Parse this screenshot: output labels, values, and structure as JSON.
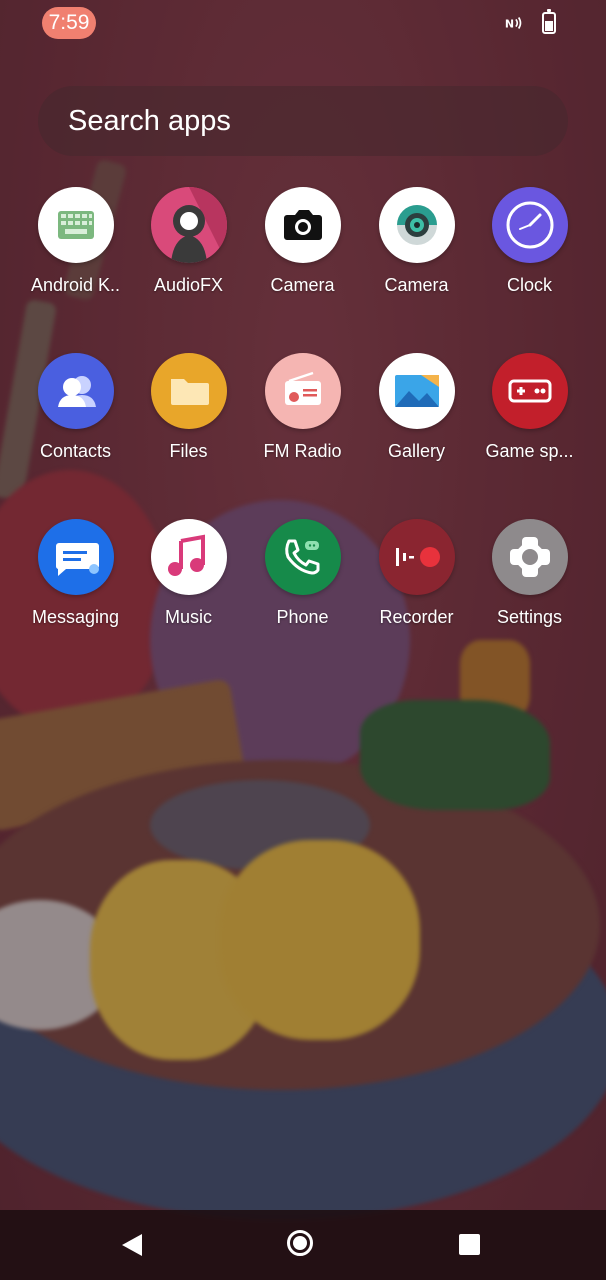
{
  "status_bar": {
    "time": "7:59",
    "icons": [
      "nfc-icon",
      "battery-icon"
    ]
  },
  "search": {
    "placeholder": "Search apps"
  },
  "apps": [
    {
      "label": "Android K..",
      "icon": "keyboard-icon"
    },
    {
      "label": "AudioFX",
      "icon": "audiofx-icon"
    },
    {
      "label": "Camera",
      "icon": "camera-icon"
    },
    {
      "label": "Camera",
      "icon": "camera-lens-icon"
    },
    {
      "label": "Clock",
      "icon": "clock-icon"
    },
    {
      "label": "Contacts",
      "icon": "contacts-icon"
    },
    {
      "label": "Files",
      "icon": "folder-icon"
    },
    {
      "label": "FM Radio",
      "icon": "radio-icon"
    },
    {
      "label": "Gallery",
      "icon": "gallery-icon"
    },
    {
      "label": "Game sp...",
      "icon": "gamepad-icon"
    },
    {
      "label": "Messaging",
      "icon": "message-icon"
    },
    {
      "label": "Music",
      "icon": "music-icon"
    },
    {
      "label": "Phone",
      "icon": "phone-icon"
    },
    {
      "label": "Recorder",
      "icon": "recorder-icon"
    },
    {
      "label": "Settings",
      "icon": "settings-icon"
    }
  ],
  "navbar": {
    "icons": [
      "back-icon",
      "home-icon",
      "recents-icon"
    ]
  },
  "colors": {
    "clock_pill": "#f08070",
    "nav_bg": "#1e0e12"
  }
}
